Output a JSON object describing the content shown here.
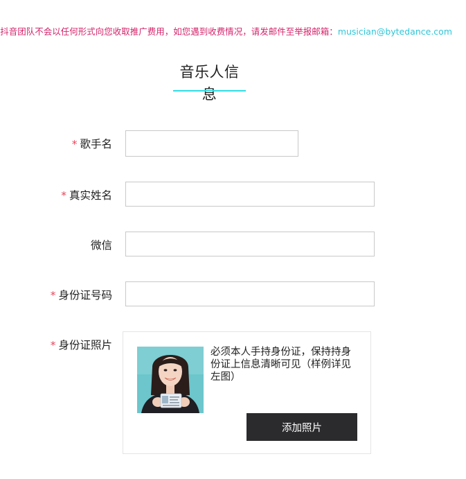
{
  "notice": {
    "text": "抖音团队不会以任何形式向您收取推广费用，如您遇到收费情况，请发邮件至举报邮箱：",
    "email": "musician@bytedance.com"
  },
  "page": {
    "title": "音乐人信息"
  },
  "form": {
    "required_mark": "*",
    "singer_name": {
      "label": "歌手名",
      "value": ""
    },
    "real_name": {
      "label": "真实姓名",
      "value": ""
    },
    "wechat": {
      "label": "微信",
      "value": ""
    },
    "id_number": {
      "label": "身份证号码",
      "value": ""
    },
    "id_photo": {
      "label": "身份证照片",
      "tip": "必须本人手持身份证，保持持身份证上信息清晰可见（样例详见左图）",
      "button_label": "添加照片"
    }
  },
  "colors": {
    "notice_text": "#d4256b",
    "link": "#2ec6d8",
    "accent_underline": "#2fdde3",
    "required": "#e8455c",
    "button_bg": "#2b2b2e"
  }
}
